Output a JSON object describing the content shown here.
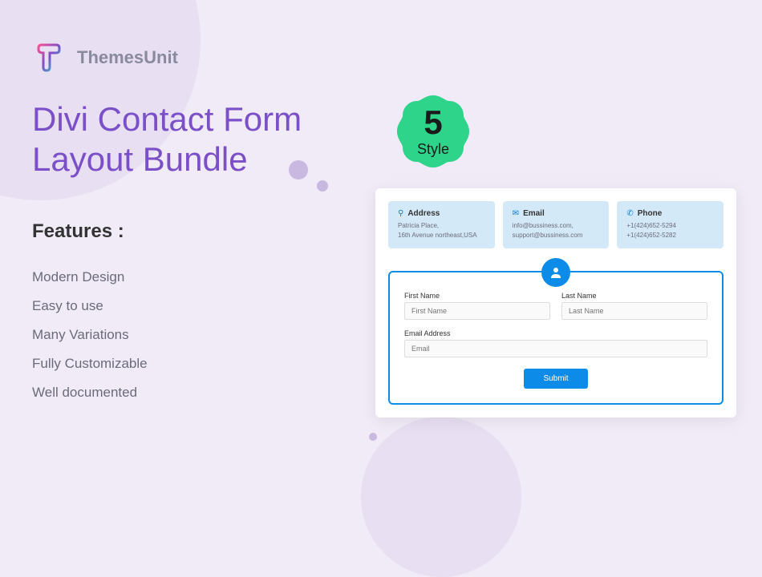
{
  "brand": {
    "name": "ThemesUnit"
  },
  "title": "Divi Contact Form Layout Bundle",
  "badge": {
    "number": "5",
    "label": "Style"
  },
  "features": {
    "heading": "Features :",
    "items": [
      "Modern Design",
      "Easy to use",
      "Many Variations",
      "Fully Customizable",
      "Well documented"
    ]
  },
  "preview": {
    "info": [
      {
        "icon": "📍",
        "title": "Address",
        "line1": "Patricia Place,",
        "line2": "16th Avenue northeast,USA"
      },
      {
        "icon": "✉",
        "title": "Email",
        "line1": "info@bussiness.com,",
        "line2": "support@bussiness.com"
      },
      {
        "icon": "📞",
        "title": "Phone",
        "line1": "+1(424)652-5294",
        "line2": "+1(424)652-5282"
      }
    ],
    "form": {
      "firstName": {
        "label": "First Name",
        "placeholder": "First Name"
      },
      "lastName": {
        "label": "Last Name",
        "placeholder": "Last Name"
      },
      "email": {
        "label": "Email Address",
        "placeholder": "Email"
      },
      "submit": "Submit"
    }
  }
}
